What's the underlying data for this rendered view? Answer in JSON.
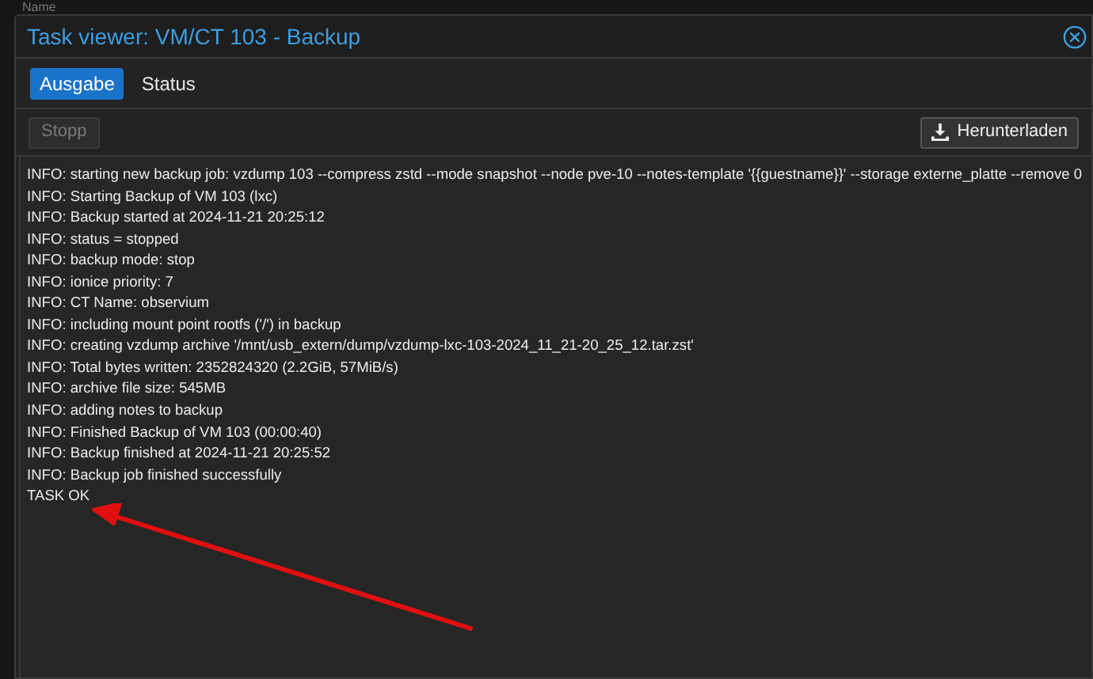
{
  "background": {
    "column_header": "Name"
  },
  "window": {
    "title": "Task viewer: VM/CT 103 - Backup"
  },
  "tabs": [
    {
      "label": "Ausgabe",
      "selected": true
    },
    {
      "label": "Status",
      "selected": false
    }
  ],
  "toolbar": {
    "stop_button": {
      "label": "Stopp",
      "disabled": true
    },
    "download_button": {
      "label": "Herunterladen"
    }
  },
  "log": [
    "INFO: starting new backup job: vzdump 103 --compress zstd --mode snapshot --node pve-10 --notes-template '{{guestname}}' --storage externe_platte --remove 0",
    "INFO: Starting Backup of VM 103 (lxc)",
    "INFO: Backup started at 2024-11-21 20:25:12",
    "INFO: status = stopped",
    "INFO: backup mode: stop",
    "INFO: ionice priority: 7",
    "INFO: CT Name: observium",
    "INFO: including mount point rootfs ('/') in backup",
    "INFO: creating vzdump archive '/mnt/usb_extern/dump/vzdump-lxc-103-2024_11_21-20_25_12.tar.zst'",
    "INFO: Total bytes written: 2352824320 (2.2GiB, 57MiB/s)",
    "INFO: archive file size: 545MB",
    "INFO: adding notes to backup",
    "INFO: Finished Backup of VM 103 (00:00:40)",
    "INFO: Backup finished at 2024-11-21 20:25:52",
    "INFO: Backup job finished successfully",
    "TASK OK"
  ]
}
